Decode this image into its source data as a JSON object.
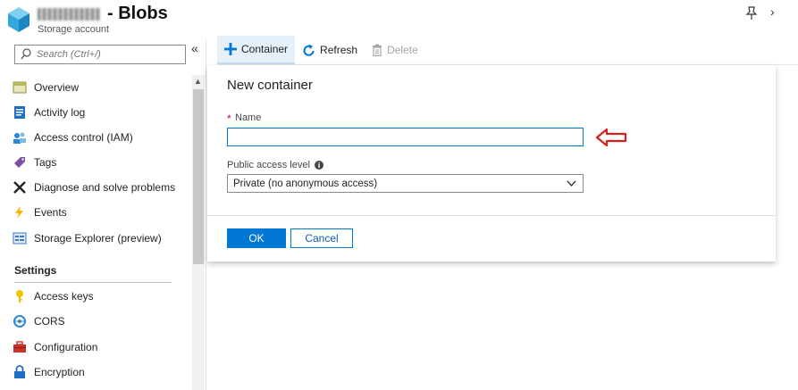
{
  "header": {
    "title": "- Blobs",
    "subtitle": "Storage account"
  },
  "sidebar": {
    "search_placeholder": "Search (Ctrl+/)",
    "items": [
      {
        "label": "Overview",
        "icon": "overview-icon"
      },
      {
        "label": "Activity log",
        "icon": "activity-log-icon"
      },
      {
        "label": "Access control (IAM)",
        "icon": "access-control-icon"
      },
      {
        "label": "Tags",
        "icon": "tag-icon"
      },
      {
        "label": "Diagnose and solve problems",
        "icon": "wrench-icon"
      },
      {
        "label": "Events",
        "icon": "lightning-icon"
      },
      {
        "label": "Storage Explorer (preview)",
        "icon": "storage-explorer-icon"
      }
    ],
    "settings_label": "Settings",
    "settings_items": [
      {
        "label": "Access keys",
        "icon": "key-icon"
      },
      {
        "label": "CORS",
        "icon": "cors-icon"
      },
      {
        "label": "Configuration",
        "icon": "toolbox-icon"
      },
      {
        "label": "Encryption",
        "icon": "lock-icon"
      }
    ]
  },
  "toolbar": {
    "container_label": "Container",
    "refresh_label": "Refresh",
    "delete_label": "Delete"
  },
  "dialog": {
    "title": "New container",
    "name_label": "Name",
    "name_value": "",
    "access_label": "Public access level",
    "access_value": "Private (no anonymous access)",
    "ok_label": "OK",
    "cancel_label": "Cancel"
  },
  "colors": {
    "accent": "#0078d4",
    "required": "#c50f1f",
    "annotation_arrow": "#d81e1e"
  }
}
